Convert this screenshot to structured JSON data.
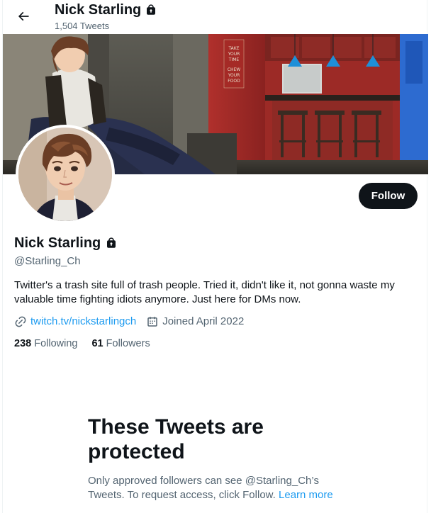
{
  "header": {
    "name": "Nick Starling",
    "tweet_count": "1,504 Tweets"
  },
  "icons": {
    "back": "arrow-left-icon",
    "protected": "lock-icon",
    "website": "link-icon",
    "joined": "calendar-icon"
  },
  "profile": {
    "name": "Nick Starling",
    "handle": "@Starling_Ch",
    "bio": "Twitter's a trash site full of trash people. Tried it, didn't like it, not gonna waste my valuable time fighting idiots anymore. Just here for DMs now.",
    "website": "twitch.tv/nickstarlingch",
    "joined": "Joined April 2022",
    "following_count": "238",
    "following_label": "Following",
    "followers_count": "61",
    "followers_label": "Followers"
  },
  "actions": {
    "follow_label": "Follow"
  },
  "banner": {
    "sign_text": "TAKE YOUR TIME CHEW YOUR FOOD"
  },
  "protected_notice": {
    "title": "These Tweets are protected",
    "description": "Only approved followers can see @Starling_Ch’s Tweets. To request access, click Follow.",
    "learn_more": "Learn more"
  },
  "colors": {
    "accent": "#1d9bf0",
    "text_primary": "#0f1419",
    "text_secondary": "#536471",
    "button_dark": "#0f1419"
  }
}
